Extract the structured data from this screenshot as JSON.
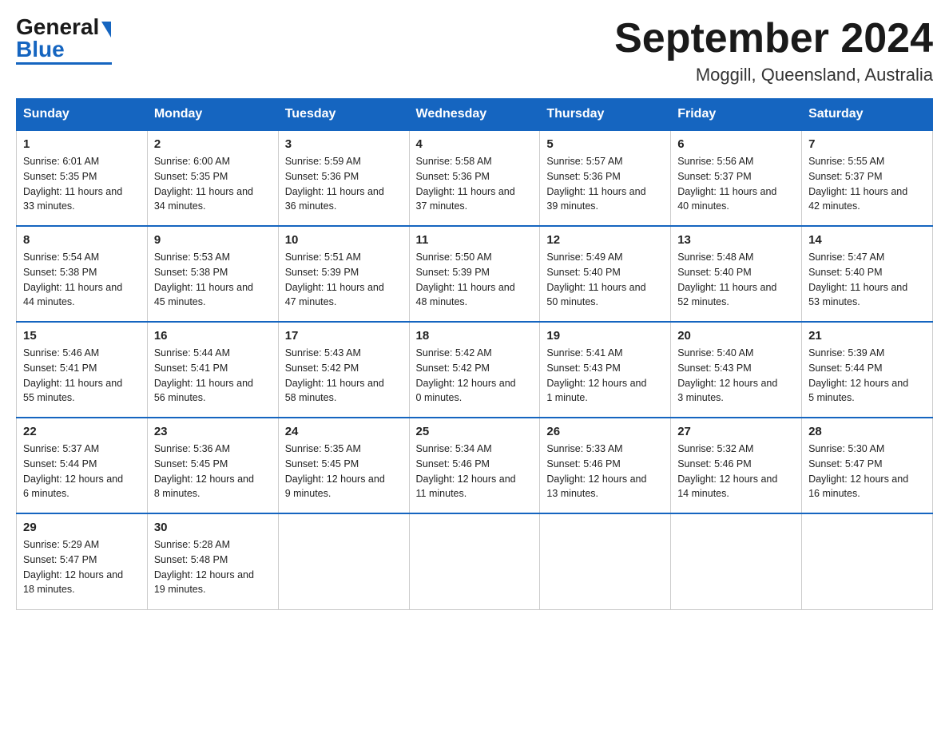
{
  "header": {
    "logo_general": "General",
    "logo_blue": "Blue",
    "month_title": "September 2024",
    "location": "Moggill, Queensland, Australia"
  },
  "days_of_week": [
    "Sunday",
    "Monday",
    "Tuesday",
    "Wednesday",
    "Thursday",
    "Friday",
    "Saturday"
  ],
  "weeks": [
    [
      {
        "day": "1",
        "sunrise": "6:01 AM",
        "sunset": "5:35 PM",
        "daylight": "11 hours and 33 minutes."
      },
      {
        "day": "2",
        "sunrise": "6:00 AM",
        "sunset": "5:35 PM",
        "daylight": "11 hours and 34 minutes."
      },
      {
        "day": "3",
        "sunrise": "5:59 AM",
        "sunset": "5:36 PM",
        "daylight": "11 hours and 36 minutes."
      },
      {
        "day": "4",
        "sunrise": "5:58 AM",
        "sunset": "5:36 PM",
        "daylight": "11 hours and 37 minutes."
      },
      {
        "day": "5",
        "sunrise": "5:57 AM",
        "sunset": "5:36 PM",
        "daylight": "11 hours and 39 minutes."
      },
      {
        "day": "6",
        "sunrise": "5:56 AM",
        "sunset": "5:37 PM",
        "daylight": "11 hours and 40 minutes."
      },
      {
        "day": "7",
        "sunrise": "5:55 AM",
        "sunset": "5:37 PM",
        "daylight": "11 hours and 42 minutes."
      }
    ],
    [
      {
        "day": "8",
        "sunrise": "5:54 AM",
        "sunset": "5:38 PM",
        "daylight": "11 hours and 44 minutes."
      },
      {
        "day": "9",
        "sunrise": "5:53 AM",
        "sunset": "5:38 PM",
        "daylight": "11 hours and 45 minutes."
      },
      {
        "day": "10",
        "sunrise": "5:51 AM",
        "sunset": "5:39 PM",
        "daylight": "11 hours and 47 minutes."
      },
      {
        "day": "11",
        "sunrise": "5:50 AM",
        "sunset": "5:39 PM",
        "daylight": "11 hours and 48 minutes."
      },
      {
        "day": "12",
        "sunrise": "5:49 AM",
        "sunset": "5:40 PM",
        "daylight": "11 hours and 50 minutes."
      },
      {
        "day": "13",
        "sunrise": "5:48 AM",
        "sunset": "5:40 PM",
        "daylight": "11 hours and 52 minutes."
      },
      {
        "day": "14",
        "sunrise": "5:47 AM",
        "sunset": "5:40 PM",
        "daylight": "11 hours and 53 minutes."
      }
    ],
    [
      {
        "day": "15",
        "sunrise": "5:46 AM",
        "sunset": "5:41 PM",
        "daylight": "11 hours and 55 minutes."
      },
      {
        "day": "16",
        "sunrise": "5:44 AM",
        "sunset": "5:41 PM",
        "daylight": "11 hours and 56 minutes."
      },
      {
        "day": "17",
        "sunrise": "5:43 AM",
        "sunset": "5:42 PM",
        "daylight": "11 hours and 58 minutes."
      },
      {
        "day": "18",
        "sunrise": "5:42 AM",
        "sunset": "5:42 PM",
        "daylight": "12 hours and 0 minutes."
      },
      {
        "day": "19",
        "sunrise": "5:41 AM",
        "sunset": "5:43 PM",
        "daylight": "12 hours and 1 minute."
      },
      {
        "day": "20",
        "sunrise": "5:40 AM",
        "sunset": "5:43 PM",
        "daylight": "12 hours and 3 minutes."
      },
      {
        "day": "21",
        "sunrise": "5:39 AM",
        "sunset": "5:44 PM",
        "daylight": "12 hours and 5 minutes."
      }
    ],
    [
      {
        "day": "22",
        "sunrise": "5:37 AM",
        "sunset": "5:44 PM",
        "daylight": "12 hours and 6 minutes."
      },
      {
        "day": "23",
        "sunrise": "5:36 AM",
        "sunset": "5:45 PM",
        "daylight": "12 hours and 8 minutes."
      },
      {
        "day": "24",
        "sunrise": "5:35 AM",
        "sunset": "5:45 PM",
        "daylight": "12 hours and 9 minutes."
      },
      {
        "day": "25",
        "sunrise": "5:34 AM",
        "sunset": "5:46 PM",
        "daylight": "12 hours and 11 minutes."
      },
      {
        "day": "26",
        "sunrise": "5:33 AM",
        "sunset": "5:46 PM",
        "daylight": "12 hours and 13 minutes."
      },
      {
        "day": "27",
        "sunrise": "5:32 AM",
        "sunset": "5:46 PM",
        "daylight": "12 hours and 14 minutes."
      },
      {
        "day": "28",
        "sunrise": "5:30 AM",
        "sunset": "5:47 PM",
        "daylight": "12 hours and 16 minutes."
      }
    ],
    [
      {
        "day": "29",
        "sunrise": "5:29 AM",
        "sunset": "5:47 PM",
        "daylight": "12 hours and 18 minutes."
      },
      {
        "day": "30",
        "sunrise": "5:28 AM",
        "sunset": "5:48 PM",
        "daylight": "12 hours and 19 minutes."
      },
      null,
      null,
      null,
      null,
      null
    ]
  ]
}
